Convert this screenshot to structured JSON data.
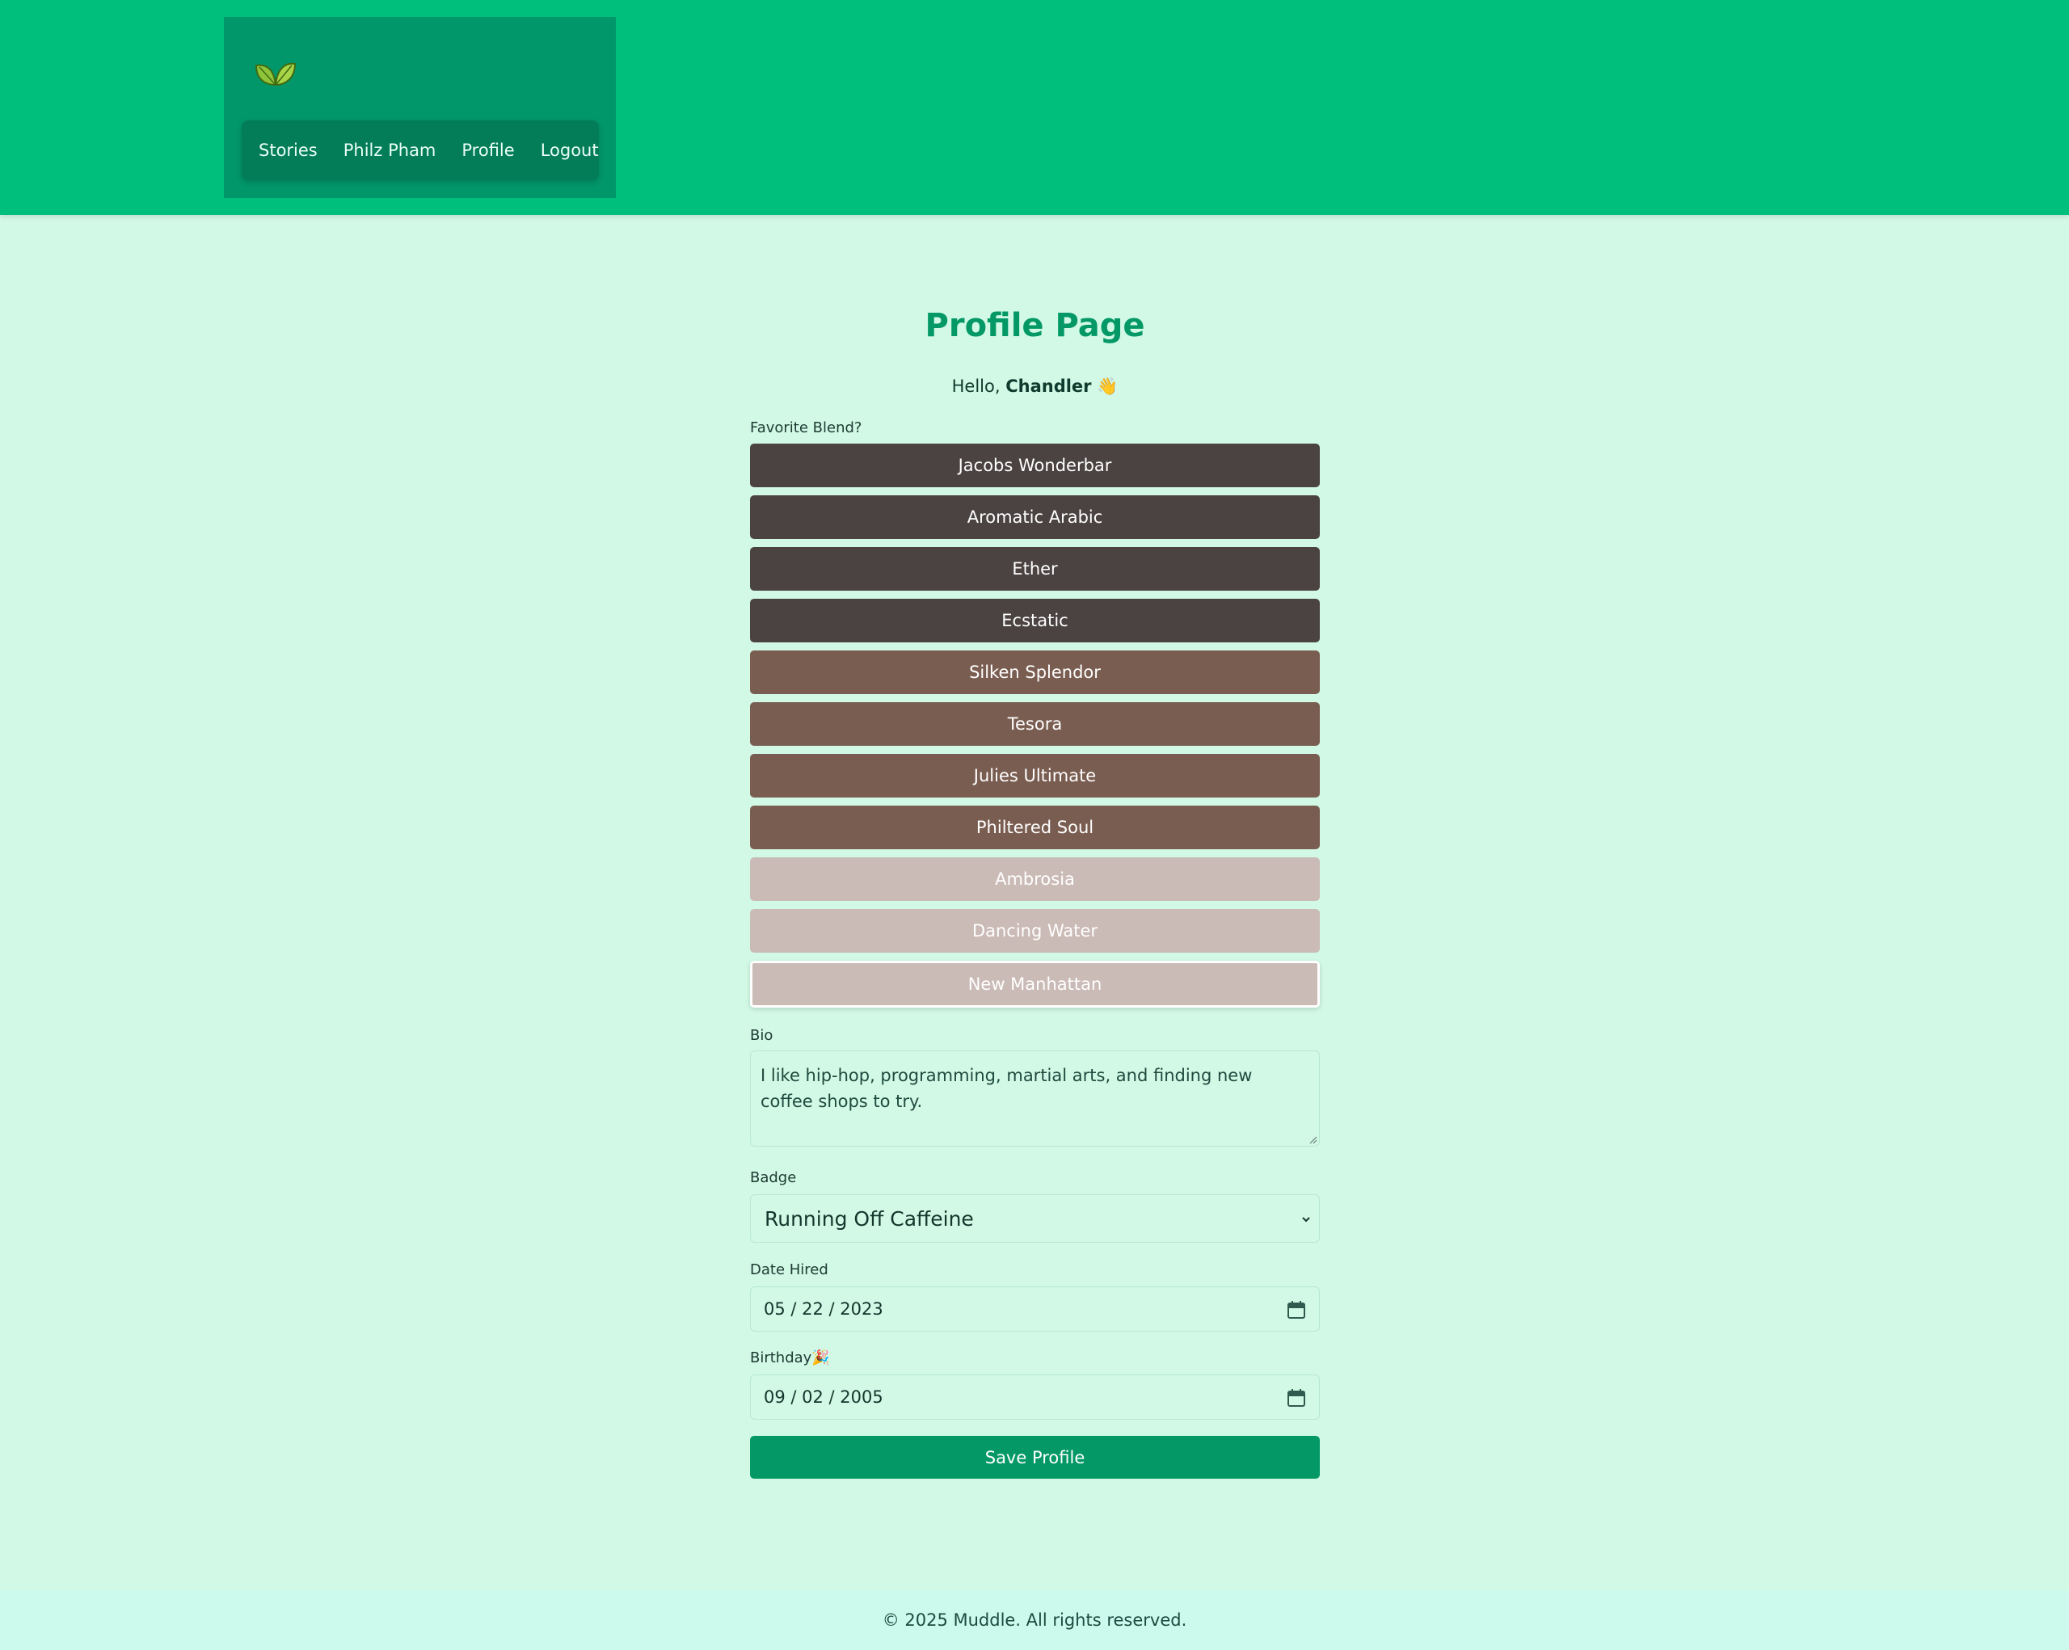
{
  "nav": {
    "logo_icon": "leaf-icon",
    "items": [
      {
        "label": "Stories"
      },
      {
        "label": "Philz Pham"
      },
      {
        "label": "Profile"
      },
      {
        "label": "Logout"
      }
    ]
  },
  "main": {
    "title": "Profile Page",
    "greeting_prefix": "Hello, ",
    "user_name": "Chandler",
    "greeting_emoji": "👋",
    "favorite_blend_label": "Favorite Blend?",
    "blends": [
      {
        "label": "Jacobs Wonderbar",
        "roast": "dark"
      },
      {
        "label": "Aromatic Arabic",
        "roast": "dark"
      },
      {
        "label": "Ether",
        "roast": "dark"
      },
      {
        "label": "Ecstatic",
        "roast": "dark"
      },
      {
        "label": "Silken Splendor",
        "roast": "medium"
      },
      {
        "label": "Tesora",
        "roast": "medium"
      },
      {
        "label": "Julies Ultimate",
        "roast": "medium"
      },
      {
        "label": "Philtered Soul",
        "roast": "medium"
      },
      {
        "label": "Ambrosia",
        "roast": "light"
      },
      {
        "label": "Dancing Water",
        "roast": "light"
      },
      {
        "label": "New Manhattan",
        "roast": "light",
        "selected": true
      }
    ],
    "bio_label": "Bio",
    "bio_value": "I like hip-hop, programming, martial arts, and finding new coffee shops to try.",
    "badge_label": "Badge",
    "badge_value": "Running Off Caffeine",
    "date_hired_label": "Date Hired",
    "date_hired_value": "05 / 22 / 2023",
    "birthday_label": "Birthday🎉",
    "birthday_value": "09 / 02 / 2005",
    "save_label": "Save Profile"
  },
  "footer": {
    "text": "© 2025 Muddle. All rights reserved."
  },
  "colors": {
    "header": "#00bf7d",
    "brand_box": "#02976a",
    "nav": "#037c58",
    "page_bg": "#d1f9e5",
    "title": "#039866",
    "dark_roast": "#4b4242",
    "medium_roast": "#7a5d51",
    "light_roast": "#cbbbb6",
    "save_button": "#039866"
  }
}
